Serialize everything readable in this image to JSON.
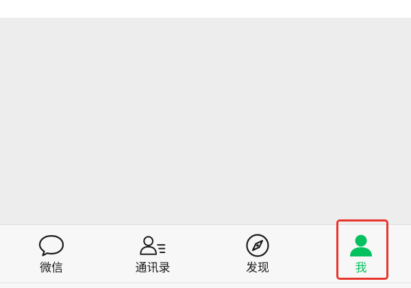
{
  "tab_bar": {
    "items": [
      {
        "label": "微信",
        "icon": "chat-bubble-icon",
        "active": false
      },
      {
        "label": "通讯录",
        "icon": "contacts-icon",
        "active": false
      },
      {
        "label": "发现",
        "icon": "compass-icon",
        "active": false
      },
      {
        "label": "我",
        "icon": "person-icon",
        "active": true
      }
    ]
  },
  "colors": {
    "active": "#07c160",
    "inactive": "#1a1a1a",
    "highlight": "#e8332a",
    "content_background": "#ededed",
    "tab_bar_background": "#f7f7f7"
  }
}
